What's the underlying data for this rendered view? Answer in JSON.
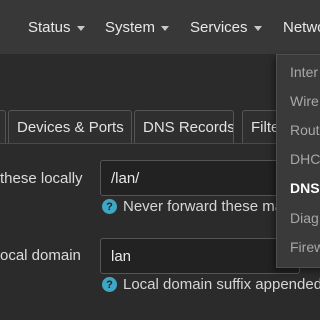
{
  "nav": {
    "status": "Status",
    "system": "System",
    "services": "Services",
    "network": "Netwo"
  },
  "tabs": [
    "Devices & Ports",
    "DNS Records",
    "Filte"
  ],
  "form": {
    "local_server": {
      "label": "these locally",
      "value": "/lan/",
      "hint": "Never forward these ma"
    },
    "local_domain": {
      "label": "ocal domain",
      "value": "lan",
      "hint": "Local domain suffix appended t"
    }
  },
  "dropdown": {
    "items": [
      "Inter",
      "Wire",
      "Rout",
      "DHC",
      "DNS",
      "Diag",
      "Firew"
    ],
    "active_index": 4
  },
  "colors": {
    "background": "#2b2b2b",
    "navbar": "#383838",
    "help_icon": "#3fa7c6"
  }
}
